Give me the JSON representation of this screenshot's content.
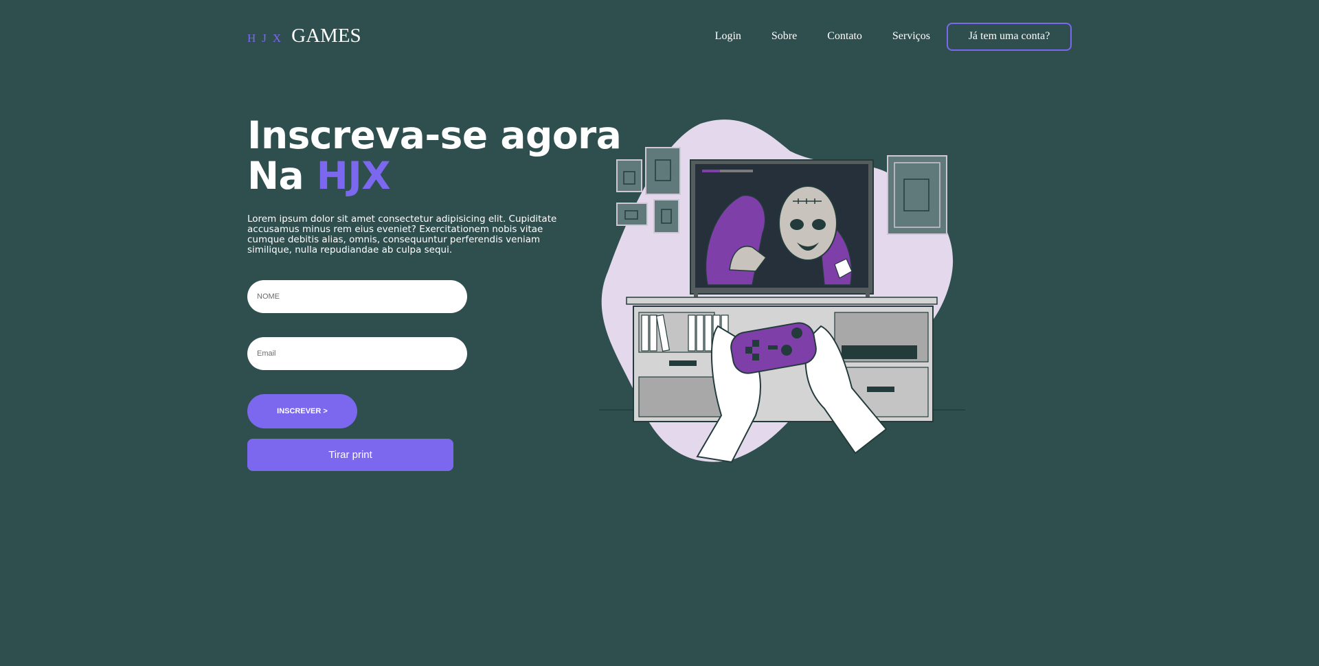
{
  "header": {
    "logo_mark": "HJX",
    "logo_text": "GAMES",
    "nav": {
      "login": "Login",
      "about": "Sobre",
      "contact": "Contato",
      "services": "Serviços"
    },
    "account_button": "Já tem uma conta?"
  },
  "hero": {
    "title_line1": "Inscreva-se agora",
    "title_line2_prefix": "Na ",
    "title_accent": "HJX",
    "description": "Lorem ipsum dolor sit amet consectetur adipisicing elit. Cupiditate accusamus minus rem eius eveniet? Exercitationem nobis vitae cumque debitis alias, omnis, consequuntur perferendis veniam similique, nulla repudiandae ab culpa sequi."
  },
  "form": {
    "name_placeholder": "NOME",
    "name_value": "",
    "email_placeholder": "Email",
    "email_value": "",
    "subscribe_label": "INSCREVER >",
    "print_label": "Tirar print"
  },
  "colors": {
    "background": "#2f4f4f",
    "accent": "#7b68ee",
    "blob": "#e4d9ec",
    "console_purple": "#7f3fa8"
  },
  "illustration": {
    "icon": "gamer-zombie-tv-illustration"
  }
}
